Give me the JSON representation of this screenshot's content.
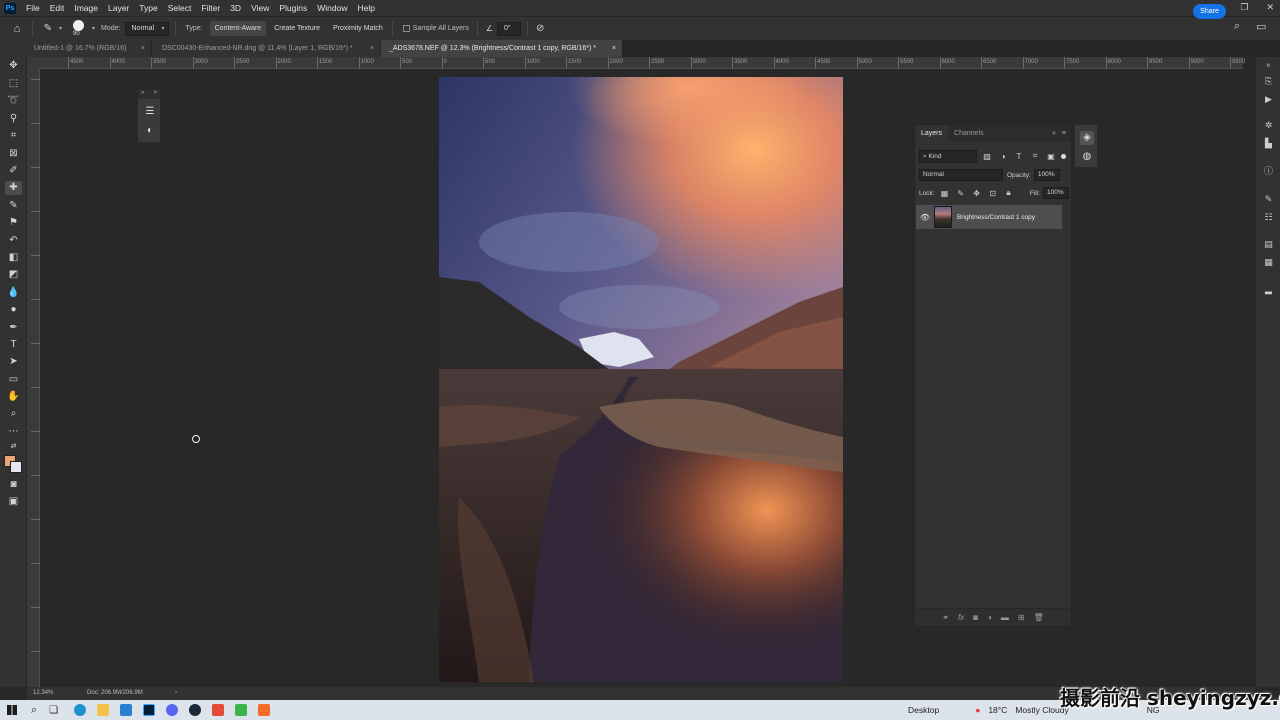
{
  "app": {
    "name": "Adobe Photoshop",
    "logo_text": "Ps",
    "menus": [
      "File",
      "Edit",
      "Image",
      "Layer",
      "Type",
      "Select",
      "Filter",
      "3D",
      "View",
      "Plugins",
      "Window",
      "Help"
    ],
    "window_controls": [
      "–",
      "❐",
      "✕"
    ]
  },
  "options_bar": {
    "brush_size": "90",
    "mode_label": "Mode:",
    "mode_value": "Normal",
    "type_label": "Type:",
    "type_buttons": [
      "Content-Aware",
      "Create Texture",
      "Proximity Match"
    ],
    "active_type": "Content-Aware",
    "sample_all_layers_label": "Sample All Layers",
    "sample_all_layers_checked": false,
    "angle_value": "0°",
    "share_label": "Share"
  },
  "tabs": [
    {
      "label": "Untitled-1 @ 16.7% (RGB/16)",
      "close": "×",
      "active": false
    },
    {
      "label": "DSC00430-Enhanced-NR.dng @ 11.4% (Layer 1, RGB/16*) *",
      "close": "×",
      "active": false
    },
    {
      "label": "_ADS3678.NEF @ 12.3% (Brightness/Contrast 1 copy, RGB/16*) *",
      "close": "×",
      "active": true
    }
  ],
  "ruler": {
    "top_labels": [
      "4500",
      "4000",
      "3500",
      "3000",
      "2500",
      "2000",
      "1500",
      "1000",
      "500",
      "0",
      "500",
      "1000",
      "1500",
      "2000",
      "2500",
      "3000",
      "3500",
      "4000",
      "4500",
      "5000",
      "5500",
      "6000",
      "6500",
      "7000",
      "7500",
      "8000",
      "8500",
      "9000",
      "9500"
    ]
  },
  "toolbar": {
    "active_tool": "spot-healing-brush",
    "foreground_color": "#e8a67a",
    "background_color": "#e9e5ef"
  },
  "layers_panel": {
    "tabs": [
      "Layers",
      "Channels"
    ],
    "active_tab": "Layers",
    "filter_kind": "Kind",
    "blend_mode": "Normal",
    "opacity_label": "Opacity:",
    "opacity_value": "100%",
    "lock_label": "Lock:",
    "fill_label": "Fill:",
    "fill_value": "100%",
    "layers": [
      {
        "name": "Brightness/Contrast 1 copy",
        "visible": true,
        "selected": true
      }
    ],
    "footer_icons": [
      "link-icon",
      "fx-icon",
      "mask-icon",
      "adjustment-icon",
      "group-folder-icon",
      "new-layer-icon",
      "trash-icon"
    ],
    "footer_fx": "fx"
  },
  "status_bar": {
    "zoom": "12.34%",
    "doc_size": "Doc: 206.9M/206.9M",
    "arrow": "›"
  },
  "taskbar": {
    "desktop_label": "Desktop",
    "weather_temp": "18°C",
    "weather_text": "Mostly Cloudy",
    "time_partial": "NG"
  },
  "watermark": "摄影前沿 sheyingzyz.com"
}
